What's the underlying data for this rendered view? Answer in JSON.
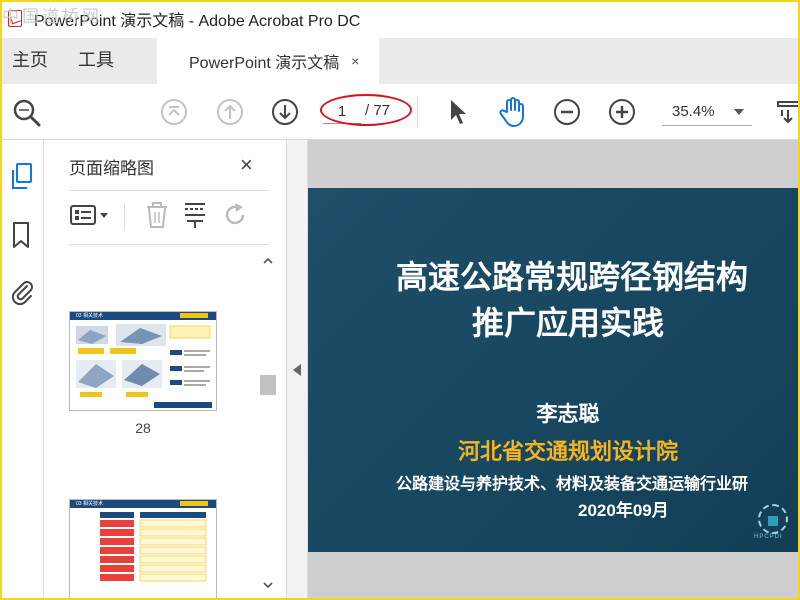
{
  "window": {
    "title": "PowerPoint 演示文稿 - Adobe Acrobat Pro DC",
    "watermark": "中国道桥网"
  },
  "nav": {
    "home_label": "主页",
    "tools_label": "工具",
    "doc_tab_label": "PowerPoint 演示文稿",
    "doc_tab_close": "×"
  },
  "toolbar": {
    "current_page": "1",
    "total_pages": "/ 77",
    "zoom": "35.4%",
    "icons": [
      "search-zoom-icon",
      "first-page-icon",
      "prev-page-icon",
      "next-page-icon",
      "select-arrow-icon",
      "hand-tool-icon",
      "zoom-out-icon",
      "zoom-in-icon",
      "display-options-icon"
    ]
  },
  "rail": {
    "icons": [
      "page-thumbnails-icon",
      "bookmark-icon",
      "attachment-icon"
    ]
  },
  "panel": {
    "title": "页面缩略图",
    "close": "×",
    "tools": [
      "thumbnail-options-icon",
      "delete-page-icon",
      "insert-page-icon",
      "rotate-page-icon"
    ],
    "thumbnails": [
      {
        "page_label": "28",
        "header_text": "03 相关技术"
      },
      {
        "page_label": "",
        "header_text": "03 相关技术"
      }
    ]
  },
  "slide": {
    "title_line1": "高速公路常规跨径钢结构",
    "title_line2": "推广应用实践",
    "author": "李志聪",
    "organization": "河北省交通规划设计院",
    "lab": "公路建设与养护技术、材料及装备交通运输行业研",
    "date": "2020年09月",
    "logo_text": "HPCPDI",
    "colors": {
      "background": "#184760",
      "org_text": "#f4b41e",
      "text": "#ffffff"
    }
  },
  "colors": {
    "highlight_ellipse": "#d7141b",
    "window_border": "#f4d61d",
    "hand_tool": "#1473e6"
  }
}
